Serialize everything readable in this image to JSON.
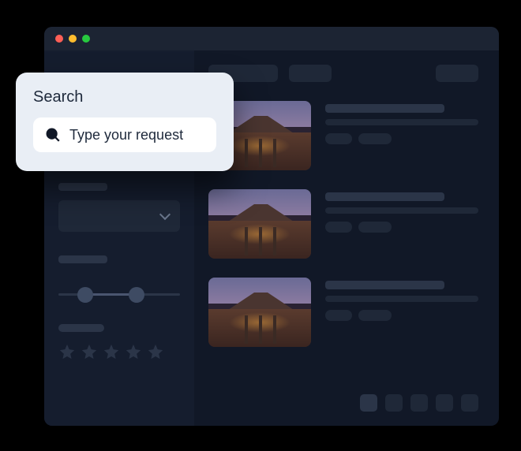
{
  "search": {
    "title": "Search",
    "placeholder": "Type your request"
  },
  "window": {
    "traffic_lights": [
      "red",
      "yellow",
      "green"
    ]
  },
  "sidebar": {
    "range_slider": {
      "min_pos_pct": 22,
      "max_pos_pct": 64
    },
    "rating_stars": 5
  },
  "listings": [
    {
      "id": 1
    },
    {
      "id": 2
    },
    {
      "id": 3
    }
  ],
  "pager": {
    "pages": 5,
    "active": 1
  }
}
